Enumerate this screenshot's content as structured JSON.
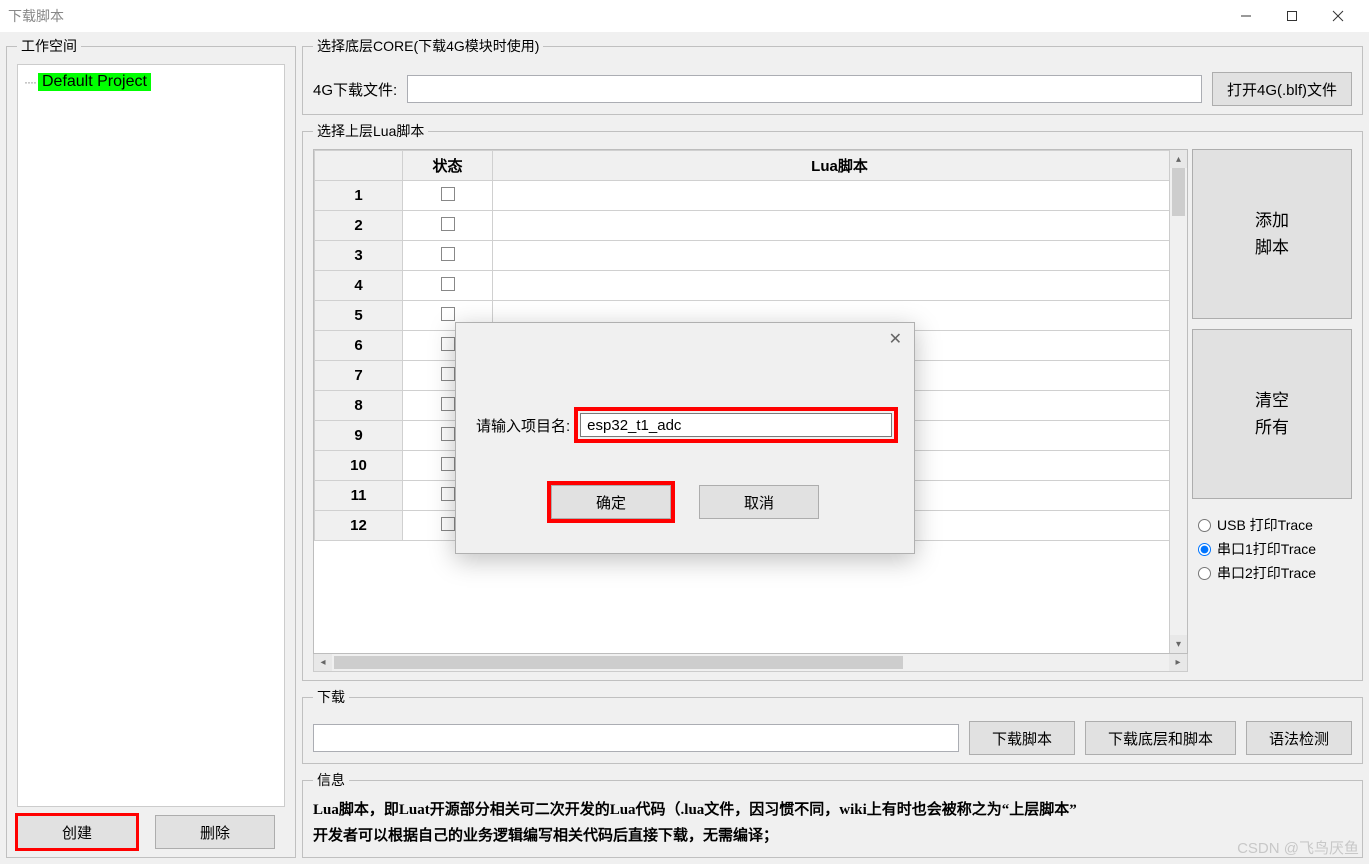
{
  "title": "下载脚本",
  "workspace": {
    "legend": "工作空间",
    "project": "Default Project",
    "create_btn": "创建",
    "delete_btn": "删除"
  },
  "core": {
    "legend": "选择底层CORE(下载4G模块时使用)",
    "label": "4G下载文件:",
    "value": "",
    "open_btn": "打开4G(.blf)文件"
  },
  "lua": {
    "legend": "选择上层Lua脚本",
    "col_status": "状态",
    "col_script": "Lua脚本",
    "rows": [
      "1",
      "2",
      "3",
      "4",
      "5",
      "6",
      "7",
      "8",
      "9",
      "10",
      "11",
      "12"
    ],
    "add_btn_l1": "添加",
    "add_btn_l2": "脚本",
    "clear_btn_l1": "清空",
    "clear_btn_l2": "所有",
    "radio_usb": "USB  打印Trace",
    "radio_s1": "串口1打印Trace",
    "radio_s2": "串口2打印Trace",
    "selected_radio": "s1"
  },
  "download": {
    "legend": "下载",
    "value": "",
    "btn_script": "下载脚本",
    "btn_core_script": "下载底层和脚本",
    "btn_syntax": "语法检测"
  },
  "info": {
    "legend": "信息",
    "line1": "Lua脚本，即Luat开源部分相关可二次开发的Lua代码（.lua文件，因习惯不同，wiki上有时也会被称之为“上层脚本”",
    "line2": "开发者可以根据自己的业务逻辑编写相关代码后直接下载，无需编译；"
  },
  "dialog": {
    "label": "请输入项目名:",
    "value": "esp32_t1_adc",
    "ok": "确定",
    "cancel": "取消"
  },
  "watermark": "CSDN @飞鸟厌鱼"
}
